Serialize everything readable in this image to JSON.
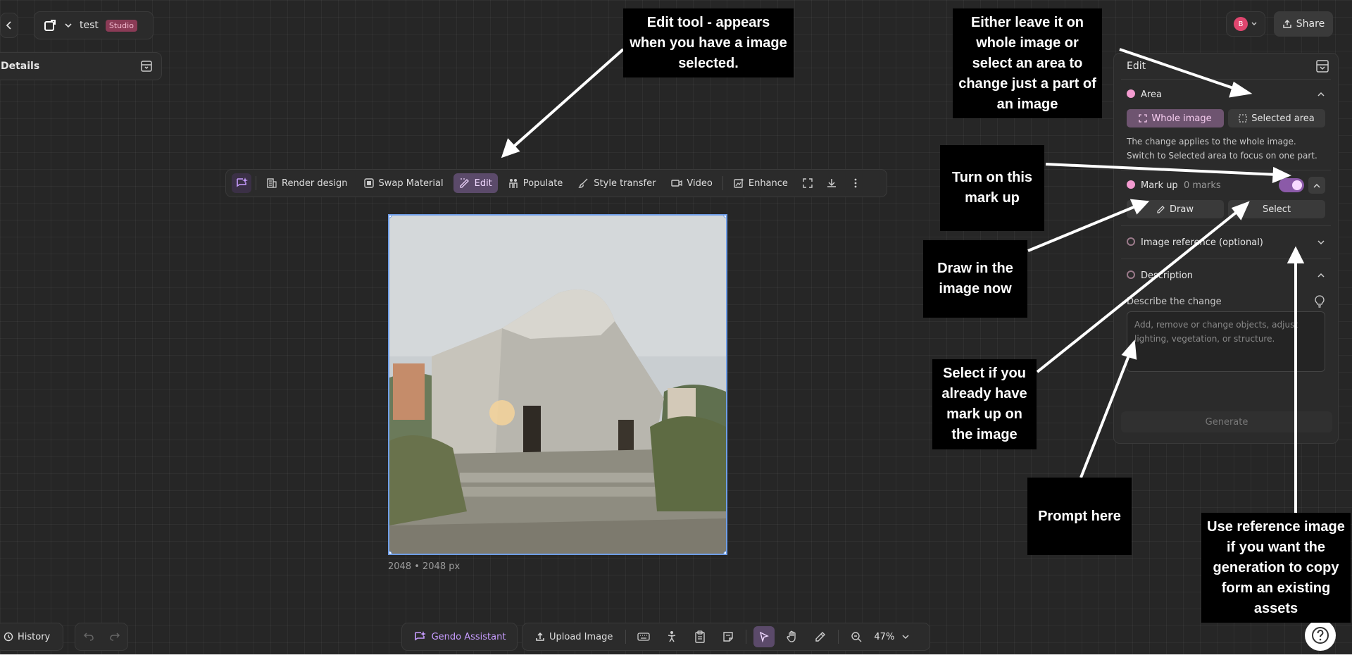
{
  "project": {
    "name": "test",
    "badge": "Studio"
  },
  "details_panel": {
    "title": "Details"
  },
  "account": {
    "avatar_initial": "B"
  },
  "share": {
    "label": "Share"
  },
  "toolbar": {
    "render_design": "Render design",
    "swap_material": "Swap Material",
    "edit": "Edit",
    "populate": "Populate",
    "style_transfer": "Style transfer",
    "video": "Video",
    "enhance": "Enhance"
  },
  "image": {
    "size_label": "2048 • 2048 px"
  },
  "edit_panel": {
    "title": "Edit",
    "area": {
      "label": "Area",
      "whole_image": "Whole image",
      "selected_area": "Selected area",
      "help": "The change applies to the whole image. Switch to Selected area to focus on one part."
    },
    "markup": {
      "label": "Mark up",
      "count": "0 marks",
      "draw": "Draw",
      "select": "Select"
    },
    "image_reference": {
      "label": "Image reference (optional)"
    },
    "description": {
      "label": "Description",
      "field_label": "Describe the change",
      "placeholder": "Add, remove or change objects, adjust lighting, vegetation, or structure."
    },
    "generate": "Generate"
  },
  "bottom_bar": {
    "history": "History",
    "assistant": "Gendo Assistant",
    "upload": "Upload Image",
    "zoom": "47%"
  },
  "annotations": {
    "edit_tool": "Edit tool - appears when you have a image selected.",
    "area": "Either leave it on whole image or select an area to change just a part of an image",
    "markup_toggle": "Turn on this mark up",
    "draw": "Draw in the image now",
    "select": "Select if you already have mark up on the image",
    "prompt": "Prompt here",
    "reference": "Use reference image if you want the generation to copy form an existing assets"
  },
  "colors": {
    "canvas": "#262626",
    "panel": "#2b2b2b",
    "accent": "#5b4a6a",
    "accent_text": "#f0d8ff",
    "selection": "#6f9ee8",
    "pink": "#f39bd0"
  }
}
